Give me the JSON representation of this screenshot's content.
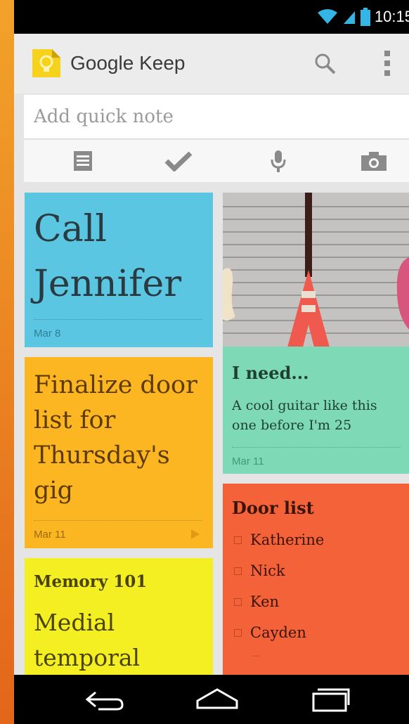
{
  "status_bar": {
    "time": "10:15"
  },
  "app_bar": {
    "title": "Google Keep"
  },
  "quick_note": {
    "placeholder": "Add quick note"
  },
  "notes": {
    "call_jennifer": {
      "title_line1": "Call",
      "title_line2": "Jennifer",
      "date": "Mar 8",
      "color": "#5bc6e2"
    },
    "finalize": {
      "lines": [
        "Finalize door",
        "list for",
        "Thursday's",
        "gig"
      ],
      "date": "Mar 11",
      "color": "#fbb622"
    },
    "memory": {
      "title": "Memory 101",
      "lines": [
        "Medial",
        "temporal"
      ],
      "color": "#f3ef23"
    },
    "guitar": {
      "title": "I need...",
      "text_line1": "A cool guitar like this",
      "text_line2": "one before I'm 25",
      "date": "Mar 11",
      "color": "#7ed9b6"
    },
    "door_list": {
      "title": "Door list",
      "items": [
        "Katherine",
        "Nick",
        "Ken",
        "Cayden"
      ],
      "more": "...",
      "color": "#f4623a"
    }
  },
  "colors": {
    "accent": "#33b5e5",
    "status_bar": "#000000",
    "nav_bar": "#000000"
  }
}
